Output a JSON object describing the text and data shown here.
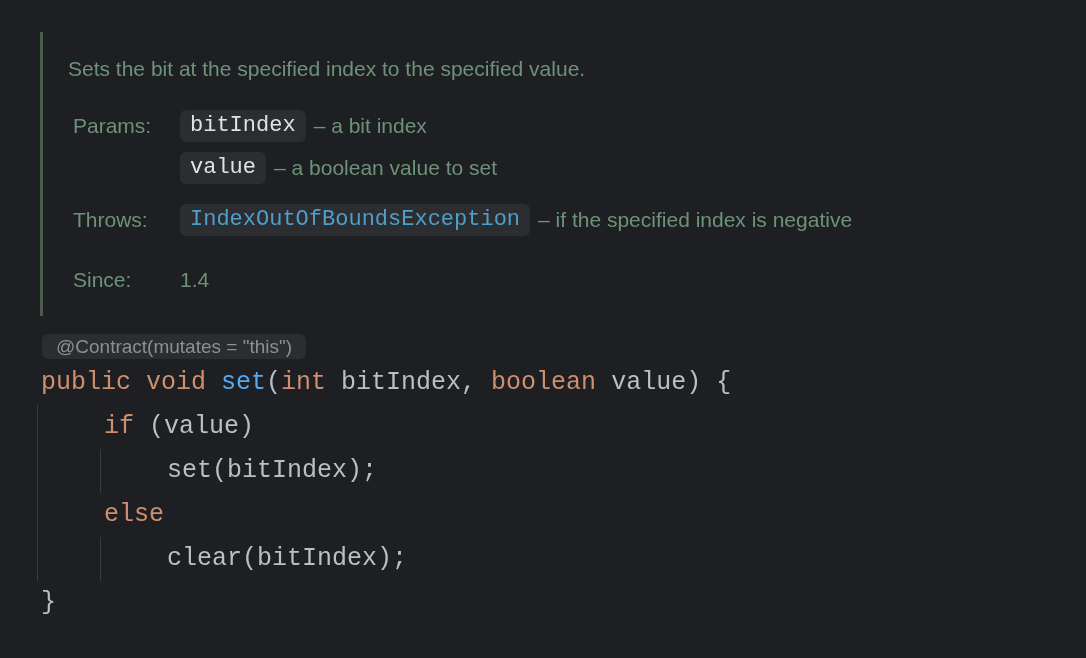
{
  "doc": {
    "summary": "Sets the bit at the specified index to the specified value.",
    "params_label": "Params:",
    "params": [
      {
        "name": "bitIndex",
        "description": "– a bit index"
      },
      {
        "name": "value",
        "description": "– a boolean value to set"
      }
    ],
    "throws_label": "Throws:",
    "throws": [
      {
        "name": "IndexOutOfBoundsException",
        "description": "– if the specified index is negative"
      }
    ],
    "since_label": "Since:",
    "since": "1.4"
  },
  "annotation": "@Contract(mutates = \"this\")",
  "code": [
    {
      "tokens": [
        {
          "kind": "keyword",
          "text": "public void "
        },
        {
          "kind": "function",
          "text": "set"
        },
        {
          "kind": "plain",
          "text": "("
        },
        {
          "kind": "keyword",
          "text": "int "
        },
        {
          "kind": "plain",
          "text": "bitIndex, "
        },
        {
          "kind": "keyword",
          "text": "boolean "
        },
        {
          "kind": "plain",
          "text": "value) {"
        }
      ],
      "children": [
        {
          "tokens": [
            {
              "kind": "keyword",
              "text": "if "
            },
            {
              "kind": "plain",
              "text": "(value)"
            }
          ],
          "children": [
            {
              "tokens": [
                {
                  "kind": "plain",
                  "text": "set(bitIndex);"
                }
              ]
            }
          ]
        },
        {
          "tokens": [
            {
              "kind": "keyword",
              "text": "else"
            }
          ],
          "children": [
            {
              "tokens": [
                {
                  "kind": "plain",
                  "text": "clear(bitIndex);"
                }
              ]
            }
          ]
        }
      ]
    },
    {
      "tokens": [
        {
          "kind": "plain",
          "text": "}"
        }
      ]
    }
  ]
}
